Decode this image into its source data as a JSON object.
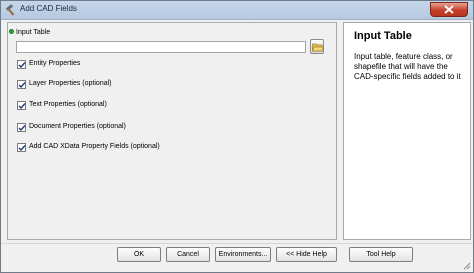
{
  "window": {
    "title": "Add CAD Fields",
    "close_label": "Close"
  },
  "form": {
    "input_label": "Input Table",
    "input_value": "",
    "checkboxes": [
      {
        "label": "Entity Properties",
        "checked": true
      },
      {
        "label": "Layer Properties (optional)",
        "checked": true
      },
      {
        "label": "Text Properties (optional)",
        "checked": true
      },
      {
        "label": "Document Properties (optional)",
        "checked": true
      },
      {
        "label": "Add CAD XData Property Fields (optional)",
        "checked": true
      }
    ]
  },
  "help": {
    "title": "Input Table",
    "body": "Input table, feature class, or shapefile that will have the CAD-specific fields added to it"
  },
  "buttons": {
    "ok": "OK",
    "cancel": "Cancel",
    "environments": "Environments...",
    "hide_help": "<< Hide Help",
    "tool_help": "Tool Help"
  },
  "icons": {
    "app": "tool-hammer-icon",
    "close": "close-icon",
    "browse": "open-folder-icon",
    "required": "required-dot-icon",
    "check": "checkmark-icon",
    "grip": "resize-grip-icon"
  },
  "colors": {
    "titlebar": "#c5d6ea",
    "close_button": "#c5412a",
    "required_dot": "#2fa52f"
  }
}
